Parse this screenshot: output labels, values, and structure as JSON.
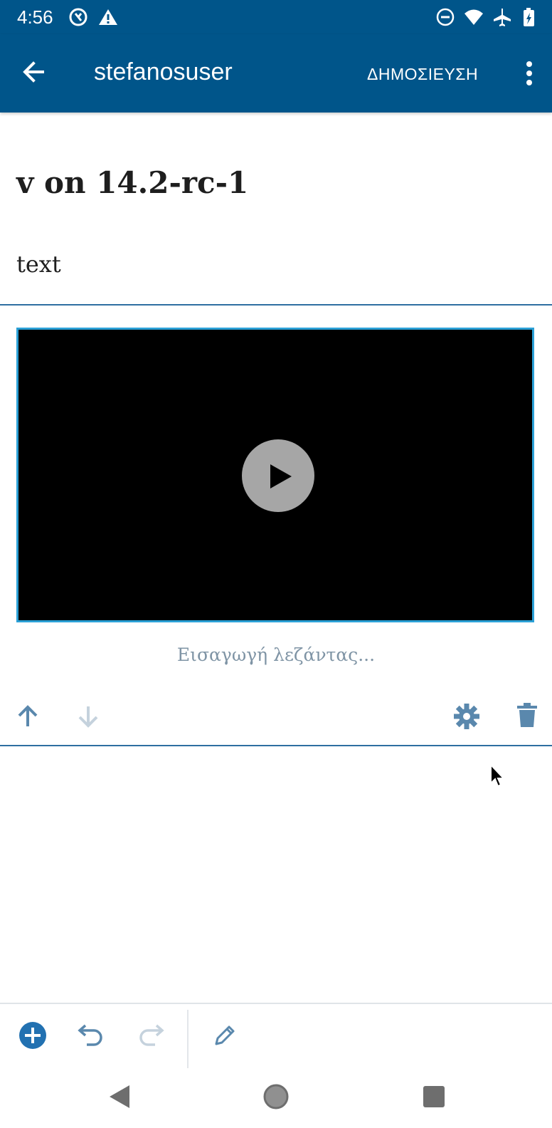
{
  "status_bar": {
    "time": "4:56",
    "icons": [
      "sync-icon",
      "alert-icon",
      "dnd-icon",
      "wifi-icon",
      "airplane-icon",
      "battery-icon"
    ]
  },
  "app_bar": {
    "title": "stefanosuser",
    "publish_label": "ΔΗΜΟΣΙΕΥΣΗ",
    "color": "#00558a"
  },
  "post": {
    "title": "v on 14.2-rc-1",
    "text": "text"
  },
  "video_block": {
    "caption_placeholder": "Εισαγωγή λεζάντας...",
    "border_color": "#2ba0d6"
  },
  "block_toolbar": {
    "icons": [
      "move-up-icon",
      "move-down-icon",
      "settings-icon",
      "delete-icon"
    ]
  },
  "bottom_toolbar": {
    "icons": [
      "add-block-icon",
      "undo-icon",
      "redo-icon",
      "edit-icon"
    ],
    "accent": "#2271b1"
  },
  "nav_bar": {
    "icons": [
      "back-nav-icon",
      "home-nav-icon",
      "recents-nav-icon"
    ]
  }
}
